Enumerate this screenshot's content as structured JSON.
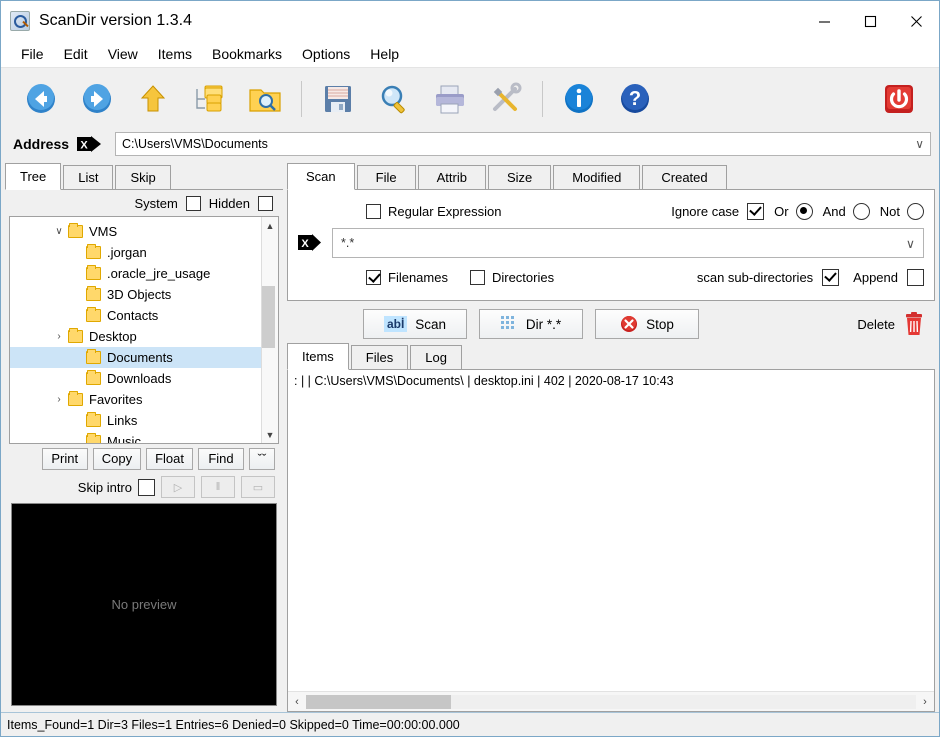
{
  "window": {
    "title": "ScanDir version 1.3.4",
    "icon": "scandir-app-icon",
    "minimize": "—",
    "maximize": "☐",
    "close": "✕"
  },
  "menubar": {
    "items": [
      "File",
      "Edit",
      "View",
      "Items",
      "Bookmarks",
      "Options",
      "Help"
    ]
  },
  "toolbar": {
    "buttons": [
      {
        "name": "back-icon",
        "label": "Back"
      },
      {
        "name": "forward-icon",
        "label": "Forward"
      },
      {
        "name": "up-icon",
        "label": "Up one level"
      },
      {
        "name": "folder-tree-icon",
        "label": "Folder tree"
      },
      {
        "name": "folder-search-icon",
        "label": "Browse folder"
      },
      {
        "name": "save-icon",
        "label": "Save"
      },
      {
        "name": "find-icon",
        "label": "Find"
      },
      {
        "name": "print-icon",
        "label": "Print"
      },
      {
        "name": "tools-icon",
        "label": "Tools"
      },
      {
        "name": "info-icon",
        "label": "Info"
      },
      {
        "name": "help-icon",
        "label": "Help"
      },
      {
        "name": "power-icon",
        "label": "Exit"
      }
    ]
  },
  "address": {
    "label": "Address",
    "value": "C:\\Users\\VMS\\Documents",
    "caret": "∨"
  },
  "left": {
    "tabs": [
      {
        "label": "Tree",
        "active": true
      },
      {
        "label": "List",
        "active": false
      },
      {
        "label": "Skip",
        "active": false
      }
    ],
    "options": [
      {
        "label": "System",
        "checked": false
      },
      {
        "label": "Hidden",
        "checked": false
      }
    ],
    "tree": [
      {
        "label": "VMS",
        "indent": 1,
        "twist": "∨",
        "selected": false
      },
      {
        "label": ".jorgan",
        "indent": 2,
        "twist": "",
        "selected": false
      },
      {
        "label": ".oracle_jre_usage",
        "indent": 2,
        "twist": "",
        "selected": false
      },
      {
        "label": "3D Objects",
        "indent": 2,
        "twist": "",
        "selected": false
      },
      {
        "label": "Contacts",
        "indent": 2,
        "twist": "",
        "selected": false
      },
      {
        "label": "Desktop",
        "indent": 2,
        "twist": "›",
        "selected": false
      },
      {
        "label": "Documents",
        "indent": 2,
        "twist": "",
        "selected": true
      },
      {
        "label": "Downloads",
        "indent": 2,
        "twist": "",
        "selected": false
      },
      {
        "label": "Favorites",
        "indent": 2,
        "twist": "›",
        "selected": false
      },
      {
        "label": "Links",
        "indent": 2,
        "twist": "",
        "selected": false
      },
      {
        "label": "Music",
        "indent": 2,
        "twist": "",
        "selected": false
      }
    ],
    "preview_buttons": [
      "Print",
      "Copy",
      "Float",
      "Find"
    ],
    "expand_button": "ˇˇ",
    "skip_intro": {
      "label": "Skip intro",
      "checked": false
    },
    "media_buttons": [
      {
        "name": "play-icon",
        "glyph": "▷"
      },
      {
        "name": "pause-icon",
        "glyph": "‖"
      },
      {
        "name": "stop-icon",
        "glyph": "▭"
      }
    ],
    "preview_placeholder": "No preview"
  },
  "right": {
    "tabs": [
      {
        "label": "Scan",
        "active": true
      },
      {
        "label": "File",
        "active": false
      },
      {
        "label": "Attrib",
        "active": false
      },
      {
        "label": "Size",
        "active": false
      },
      {
        "label": "Modified",
        "active": false
      },
      {
        "label": "Created",
        "active": false
      }
    ],
    "scan": {
      "regular_expression": {
        "label": "Regular Expression",
        "checked": false
      },
      "ignore_case": {
        "label": "Ignore case",
        "checked": true
      },
      "logic": [
        {
          "label": "Or",
          "selected": true
        },
        {
          "label": "And",
          "selected": false
        },
        {
          "label": "Not",
          "selected": false
        }
      ],
      "pattern": "*.*",
      "pattern_caret": "∨",
      "filenames": {
        "label": "Filenames",
        "checked": true
      },
      "directories": {
        "label": "Directories",
        "checked": false
      },
      "scan_sub_directories": {
        "label": "scan sub-directories",
        "checked": true
      },
      "append": {
        "label": "Append",
        "checked": false
      }
    },
    "actions": {
      "scan": {
        "label": "Scan",
        "icon": "ab-cursor-icon",
        "icon_text": "abİ"
      },
      "dir": {
        "label": "Dir *.*",
        "icon": "grid-icon"
      },
      "stop": {
        "label": "Stop",
        "icon": "stop-x-icon"
      },
      "delete": {
        "label": "Delete",
        "icon": "trash-icon"
      }
    },
    "result_tabs": [
      {
        "label": "Items",
        "active": true
      },
      {
        "label": "Files",
        "active": false
      },
      {
        "label": "Log",
        "active": false
      }
    ],
    "results": [
      ": |  | C:\\Users\\VMS\\Documents\\ | desktop.ini | 402 | 2020-08-17 10:43"
    ],
    "scroll_left": "‹",
    "scroll_right": "›"
  },
  "statusbar": {
    "text": "Items_Found=1 Dir=3 Files=1 Entries=6 Denied=0 Skipped=0 Time=00:00:00.000"
  },
  "colors": {
    "selection": "#cce4f7",
    "accent_blue": "#1b6ec2",
    "danger_red": "#cc2027",
    "folder_yellow": "#ffd86b"
  }
}
